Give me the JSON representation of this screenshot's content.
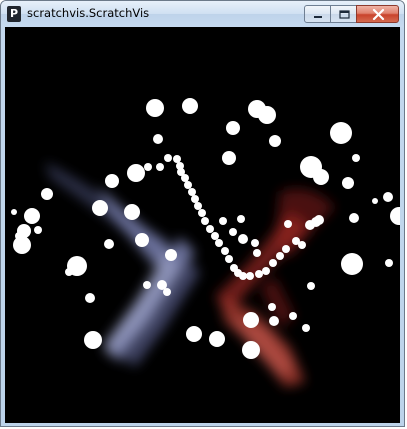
{
  "window": {
    "title": "scratchvis.ScratchVis",
    "app_icon_glyph": "P"
  },
  "caption_buttons": {
    "minimize_icon": "minimize-icon",
    "maximize_icon": "maximize-icon",
    "close_icon": "close-icon"
  },
  "colors": {
    "canvas_background": "#000000",
    "dots": "#ffffff",
    "left_streak": "#8f98d6",
    "right_streak": "#d84a3c",
    "close_button": "#c9432c"
  }
}
